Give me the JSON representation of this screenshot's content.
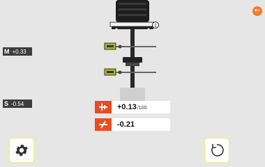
{
  "marker": "1",
  "close_icon": "arrow-left-icon",
  "side_labels": {
    "m": {
      "key": "M",
      "value": "+0.33"
    },
    "s": {
      "key": "S",
      "value": "-0.54"
    }
  },
  "readouts": {
    "offset": {
      "icon": "offset-icon",
      "value": "+0.13",
      "unit": "/100"
    },
    "angle": {
      "icon": "angle-icon",
      "value": "-0.21"
    }
  },
  "toolbar": {
    "settings_icon": "gear-icon",
    "reset_icon": "rotate-icon"
  },
  "colors": {
    "accent": "#e84c22",
    "close": "#f07d2d",
    "highlight": "#e8ef9c",
    "label_bg": "#3d3d3d"
  }
}
